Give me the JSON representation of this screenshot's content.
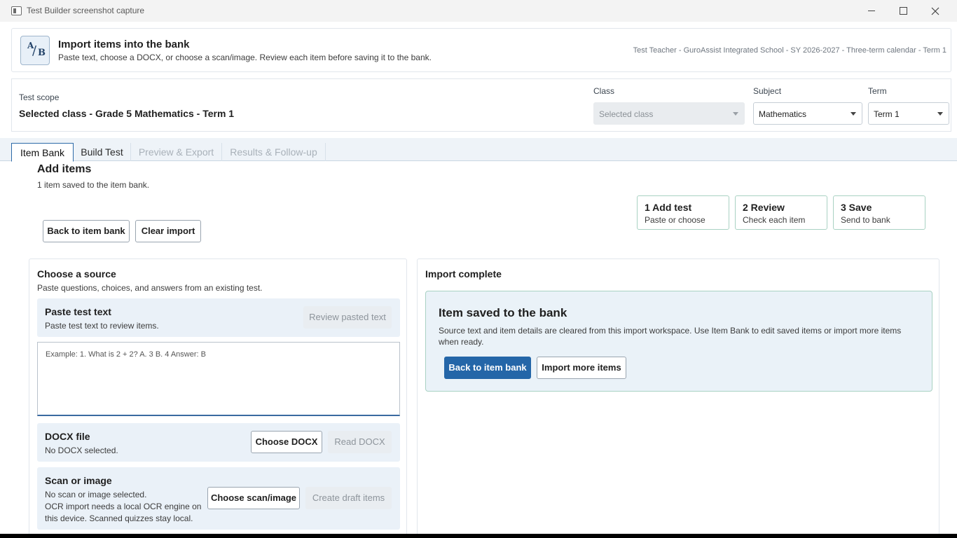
{
  "window": {
    "title": "Test Builder screenshot capture"
  },
  "header": {
    "logo_letters": [
      "A",
      "/",
      "B"
    ],
    "title": "Import items into the bank",
    "subtitle": "Paste text, choose a DOCX, or choose a scan/image. Review each item before saving it to the bank.",
    "context": "Test Teacher - GuroAssist Integrated School - SY 2026-2027 - Three-term calendar - Term 1"
  },
  "scope": {
    "label": "Test scope",
    "value": "Selected class - Grade 5 Mathematics - Term 1",
    "class_label": "Class",
    "class_value": "Selected class",
    "subject_label": "Subject",
    "subject_value": "Mathematics",
    "term_label": "Term",
    "term_value": "Term 1"
  },
  "tabs": [
    {
      "label": "Item Bank",
      "state": "active"
    },
    {
      "label": "Build Test",
      "state": "inactive"
    },
    {
      "label": "Preview & Export",
      "state": "disabled"
    },
    {
      "label": "Results & Follow-up",
      "state": "disabled"
    }
  ],
  "add_items": {
    "title": "Add items",
    "count_text": "1 item saved to the item bank.",
    "back_button": "Back to item bank",
    "clear_button": "Clear import"
  },
  "steps": [
    {
      "title": "1  Add test",
      "sub": "Paste or choose"
    },
    {
      "title": "2  Review",
      "sub": "Check each item"
    },
    {
      "title": "3  Save",
      "sub": "Send to bank"
    }
  ],
  "source": {
    "title": "Choose a source",
    "subtitle": "Paste questions, choices, and answers from an existing test.",
    "paste": {
      "title": "Paste test text",
      "sub": "Paste test text to review items.",
      "button": "Review pasted text",
      "placeholder": "Example: 1. What is 2 + 2?  A. 3  B. 4  Answer: B"
    },
    "docx": {
      "title": "DOCX file",
      "sub": "No DOCX selected.",
      "choose_button": "Choose DOCX",
      "read_button": "Read DOCX"
    },
    "scan": {
      "title": "Scan or image",
      "sub": "No scan or image selected.",
      "note": "OCR import needs a local OCR engine on this device. Scanned quizzes stay local.",
      "choose_button": "Choose scan/image",
      "create_button": "Create draft items"
    }
  },
  "result": {
    "title": "Import complete",
    "card_title": "Item saved to the bank",
    "card_text": "Source text and item details are cleared from this import workspace. Use Item Bank to edit saved items or import more items when ready.",
    "primary_button": "Back to item bank",
    "secondary_button": "Import more items"
  },
  "colors": {
    "accent": "#2466a8",
    "success_border": "#a9d2c3",
    "panel_fill": "#eaf1f8"
  }
}
